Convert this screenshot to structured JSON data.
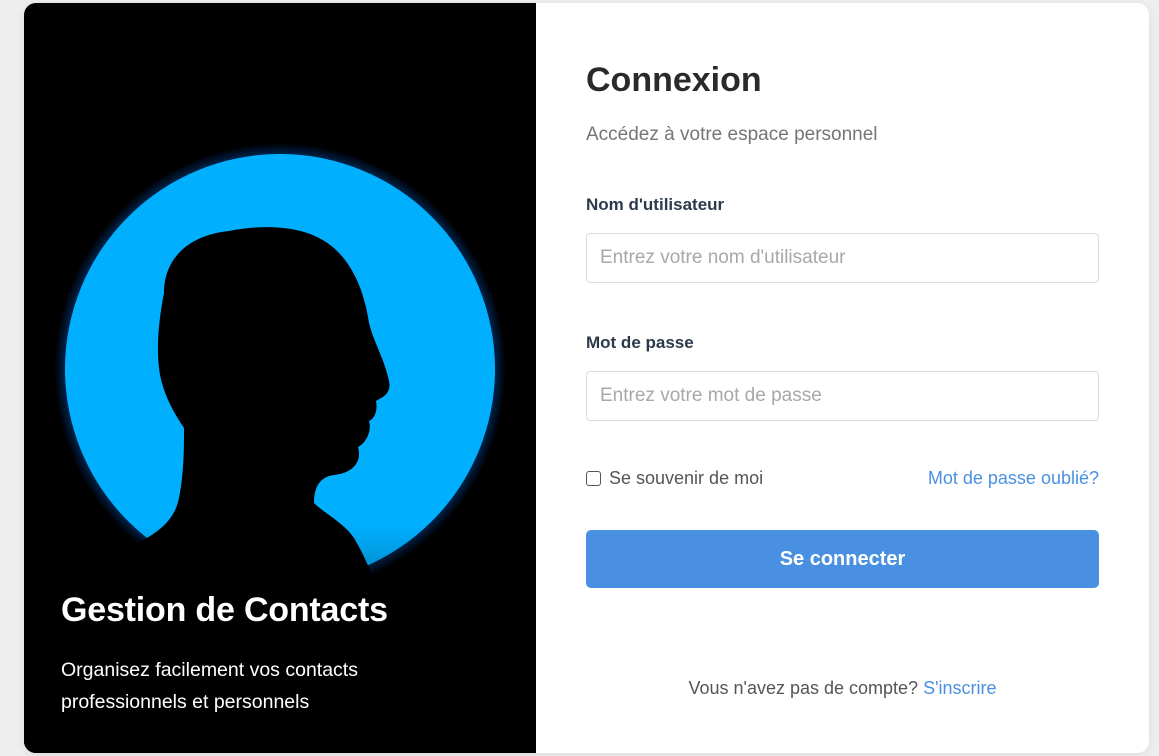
{
  "hero": {
    "title": "Gestion de Contacts",
    "subtitle": "Organisez facilement vos contacts professionnels et personnels",
    "image": "silhouette-profile-blue-circle"
  },
  "login": {
    "title": "Connexion",
    "subtitle": "Accédez à votre espace personnel",
    "username_label": "Nom d'utilisateur",
    "username_placeholder": "Entrez votre nom d'utilisateur",
    "username_value": "",
    "password_label": "Mot de passe",
    "password_placeholder": "Entrez votre mot de passe",
    "password_value": "",
    "remember_label": "Se souvenir de moi",
    "remember_checked": false,
    "forgot_label": "Mot de passe oublié?",
    "submit_label": "Se connecter",
    "footer_text": "Vous n'avez pas de compte?",
    "signup_label": "S'inscrire"
  },
  "colors": {
    "accent": "#4a90e2",
    "hero_circle": "#00b0ff",
    "hero_background": "#000000"
  }
}
